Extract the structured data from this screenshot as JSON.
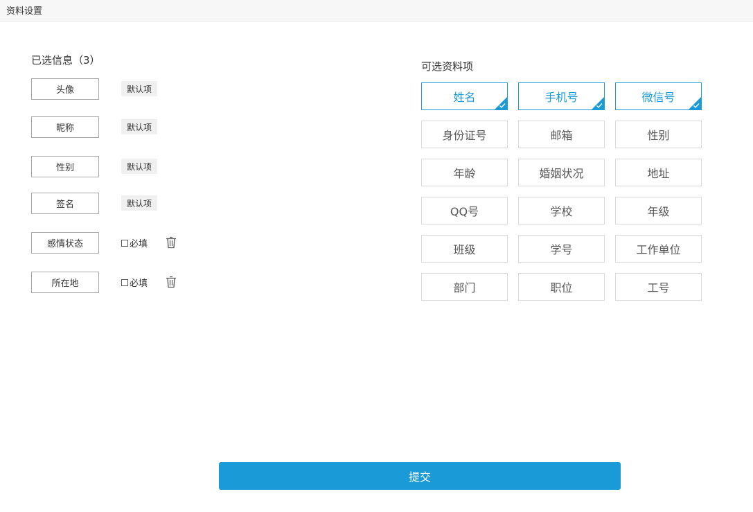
{
  "titlebar": {
    "title": "资料设置"
  },
  "selected": {
    "title": "已选信息（3）",
    "fields": [
      {
        "label": "头像",
        "badge": "默认项"
      },
      {
        "label": "昵称",
        "badge": "默认项"
      },
      {
        "label": "性别",
        "badge": "默认项"
      },
      {
        "label": "签名",
        "badge": "默认项"
      },
      {
        "label": "感情状态",
        "required_label": "必填"
      },
      {
        "label": "所在地",
        "required_label": "必填"
      }
    ]
  },
  "options": {
    "title": "可选资料项",
    "items": [
      {
        "label": "姓名",
        "selected": true
      },
      {
        "label": "手机号",
        "selected": true
      },
      {
        "label": "微信号",
        "selected": true
      },
      {
        "label": "身份证号",
        "selected": false
      },
      {
        "label": "邮箱",
        "selected": false
      },
      {
        "label": "性别",
        "selected": false
      },
      {
        "label": "年龄",
        "selected": false
      },
      {
        "label": "婚姻状况",
        "selected": false
      },
      {
        "label": "地址",
        "selected": false
      },
      {
        "label": "QQ号",
        "selected": false
      },
      {
        "label": "学校",
        "selected": false
      },
      {
        "label": "年级",
        "selected": false
      },
      {
        "label": "班级",
        "selected": false
      },
      {
        "label": "学号",
        "selected": false
      },
      {
        "label": "工作单位",
        "selected": false
      },
      {
        "label": "部门",
        "selected": false
      },
      {
        "label": "职位",
        "selected": false
      },
      {
        "label": "工号",
        "selected": false
      }
    ]
  },
  "submit": {
    "label": "提交"
  },
  "colors": {
    "accent": "#1a9bd7",
    "border": "#d9d9d9",
    "badge_bg": "#f0f0f0"
  }
}
